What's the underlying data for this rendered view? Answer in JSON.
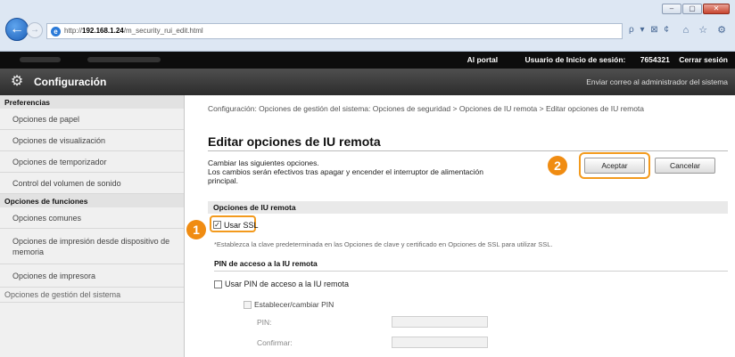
{
  "browser": {
    "url_prefix": "http://",
    "url_host": "192.168.1.24",
    "url_path": "/m_security_rui_edit.html",
    "addr_tools": "ρ ▾ ⊠ ¢",
    "fav_tools": "⌂ ☆ ⚙",
    "back_glyph": "←",
    "forward_glyph": "→"
  },
  "topbar": {
    "portal": "Al portal",
    "user_label": "Usuario de Inicio de sesión:",
    "user_id": "7654321",
    "logout": "Cerrar sesión"
  },
  "header": {
    "title": "Configuración",
    "mail_admin": "Enviar correo al administrador del sistema"
  },
  "sidebar": {
    "heading_pref": "Preferencias",
    "items_pref": [
      "Opciones de papel",
      "Opciones de visualización",
      "Opciones de temporizador",
      "Control del volumen de sonido"
    ],
    "heading_func": "Opciones de funciones",
    "items_func": [
      "Opciones comunes",
      "Opciones de impresión desde dispositivo de memoria",
      "Opciones de impresora"
    ],
    "heading_mgmt": "Opciones de gestión del sistema"
  },
  "main": {
    "breadcrumb": "Configuración: Opciones de gestión del sistema: Opciones de seguridad > Opciones de IU remota > Editar opciones de IU remota",
    "title": "Editar opciones de IU remota",
    "desc_line1": "Cambiar las siguientes opciones.",
    "desc_line2": "Los cambios serán efectivos tras apagar y encender el interruptor de alimentación",
    "desc_line3": "principal.",
    "ok_button": "Aceptar",
    "cancel_button": "Cancelar",
    "section_title": "Opciones de IU remota",
    "ssl_label": "Usar SSL",
    "ssl_note": "*Establezca la clave predeterminada en las Opciones de clave y certificado en Opciones de SSL para utilizar SSL.",
    "pin_heading": "PIN de acceso a la IU remota",
    "pin_use_label": "Usar PIN de acceso a la IU remota",
    "pin_set_label": "Establecer/cambiar PIN",
    "pin_label": "PIN:",
    "confirm_label": "Confirmar:"
  },
  "badges": {
    "one": "1",
    "two": "2"
  },
  "colors": {
    "accent": "#f08c12",
    "topbar": "#0d0d0d",
    "header": "#3a3a3a"
  }
}
